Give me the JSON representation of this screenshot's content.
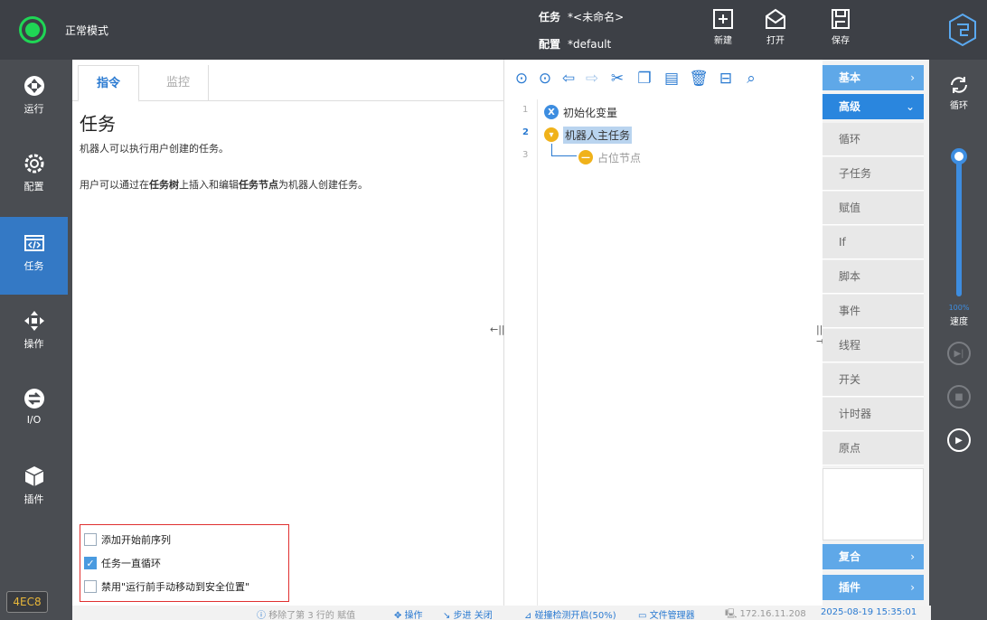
{
  "topbar": {
    "mode": "正常模式",
    "task_label": "任务",
    "task_value": "*<未命名>",
    "config_label": "配置",
    "config_value": "*default",
    "new_label": "新建",
    "open_label": "打开",
    "save_label": "保存"
  },
  "leftnav": {
    "items": [
      {
        "label": "运行",
        "icon": "run-icon"
      },
      {
        "label": "配置",
        "icon": "config-icon"
      },
      {
        "label": "任务",
        "icon": "task-icon"
      },
      {
        "label": "操作",
        "icon": "move-icon"
      },
      {
        "label": "I/O",
        "icon": "io-icon"
      },
      {
        "label": "插件",
        "icon": "plugin-icon"
      }
    ],
    "version": "4EC8"
  },
  "tabs": {
    "instructions": "指令",
    "monitor": "监控"
  },
  "help": {
    "title": "任务",
    "p1": "机器人可以执行用户创建的任务。",
    "p2_a": "用户可以通过在",
    "p2_b": "任务树",
    "p2_c": "上插入和编辑",
    "p2_d": "任务节点",
    "p2_e": "为机器人创建任务。"
  },
  "options": {
    "o1": "添加开始前序列",
    "o2": "任务一直循环",
    "o3": "禁用\"运行前手动移动到安全位置\""
  },
  "tree": {
    "lines": [
      "1",
      "2",
      "3"
    ],
    "n1": "初始化变量",
    "n2": "机器人主任务",
    "n3": "占位节点"
  },
  "categories": {
    "basic": "基本",
    "advanced": "高级",
    "advanced_items": [
      "循环",
      "子任务",
      "赋值",
      "If",
      "脚本",
      "事件",
      "线程",
      "开关",
      "计时器",
      "原点"
    ],
    "composite": "复合",
    "plugin": "插件"
  },
  "rightstrip": {
    "loop": "循环",
    "speed_pct": "100%",
    "speed_label": "速度"
  },
  "status": {
    "msg": "移除了第 3 行的 赋值",
    "op": "操作",
    "step": "步进 关闭",
    "collision": "碰撞检测开启(50%)",
    "files": "文件管理器",
    "ip": "172.16.11.208",
    "time": "2025-08-19 15:35:01"
  },
  "colors": {
    "accent": "#2a7ad1",
    "active_nav": "#3479c5",
    "status_green": "#1fd655",
    "highlight_box": "#e03030"
  }
}
